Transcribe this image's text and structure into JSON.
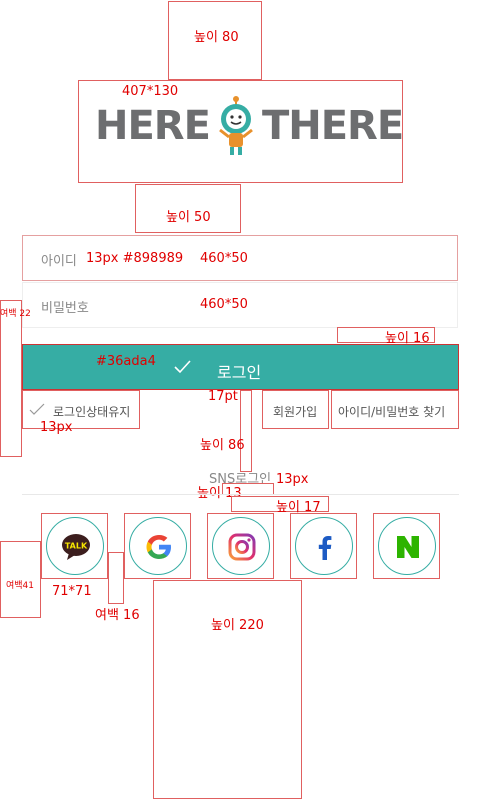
{
  "annotations": {
    "top_height": "높이 80",
    "logo_size": "407*130",
    "gap_50": "높이 50",
    "id_spec": "13px #898989",
    "id_size": "460*50",
    "pw_size": "460*50",
    "left_margin": "여백 22",
    "gap_16": "높이 16",
    "btn_color": "#36ada4",
    "btn_font": "17pt",
    "opt_font": "13px",
    "gap_86": "높이 86",
    "sns_font": "13px",
    "gap_13": "높이 13",
    "gap_17": "높이 17",
    "left_41": "여백41",
    "icon_size": "71*71",
    "icon_gap": "여백 16",
    "bottom_220": "높이 220"
  },
  "logo": {
    "left": "HERE",
    "right": "THERE"
  },
  "form": {
    "id_placeholder": "아이디",
    "pw_placeholder": "비밀번호",
    "login_label": "로그인"
  },
  "options": {
    "keep_login": "로그인상태유지",
    "signup": "회원가입",
    "find": "아이디/비밀번호 찾기"
  },
  "sns": {
    "title": "SNS로그인",
    "icons": [
      "kakaotalk-icon",
      "google-icon",
      "instagram-icon",
      "facebook-icon",
      "naver-icon"
    ],
    "kakao_text": "TALK"
  },
  "colors": {
    "accent": "#36ada4",
    "placeholder": "#898989",
    "annotation": "#e00000"
  }
}
